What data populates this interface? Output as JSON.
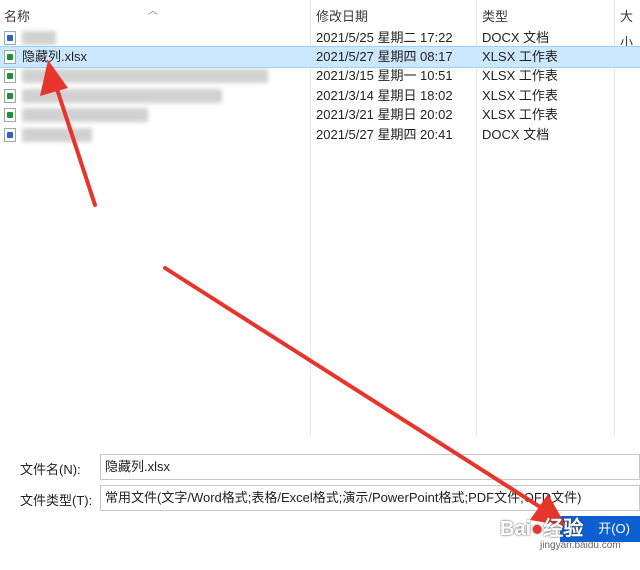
{
  "columns": {
    "name": "名称",
    "modified": "修改日期",
    "type": "类型",
    "size": "大小"
  },
  "files": [
    {
      "name": "",
      "date": "2021/5/25 星期二 17:22",
      "type": "DOCX 文档",
      "kind": "docx",
      "blurred": true,
      "selected": false
    },
    {
      "name": "隐藏列.xlsx",
      "date": "2021/5/27 星期四 08:17",
      "type": "XLSX 工作表",
      "kind": "xlsx",
      "blurred": false,
      "selected": true
    },
    {
      "name": "",
      "date": "2021/3/15 星期一 10:51",
      "type": "XLSX 工作表",
      "kind": "xlsx",
      "blurred": true,
      "selected": false
    },
    {
      "name": "",
      "date": "2021/3/14 星期日 18:02",
      "type": "XLSX 工作表",
      "kind": "xlsx",
      "blurred": true,
      "selected": false
    },
    {
      "name": "",
      "date": "2021/3/21 星期日 20:02",
      "type": "XLSX 工作表",
      "kind": "xlsx",
      "blurred": true,
      "selected": false
    },
    {
      "name": "",
      "date": "2021/5/27 星期四 20:41",
      "type": "DOCX 文档",
      "kind": "docx",
      "blurred": true,
      "selected": false
    }
  ],
  "form": {
    "filename_label": "文件名(N):",
    "filename_value": "隐藏列.xlsx",
    "filetype_label": "文件类型(T):",
    "filetype_value": "常用文件(文字/Word格式;表格/Excel格式;演示/PowerPoint格式;PDF文件;OFD文件)"
  },
  "buttons": {
    "open_label": "开(O)"
  },
  "watermark": {
    "brand": "Bai",
    "brand_suffix": "经验",
    "url": "jingyan.baidu.com"
  },
  "colors": {
    "selection": "#cce8ff",
    "annotation_arrow": "#e8352c",
    "primary_button": "#0b5fd1",
    "xlsx_icon": "#1f8f3a",
    "docx_icon": "#2b63c6"
  }
}
